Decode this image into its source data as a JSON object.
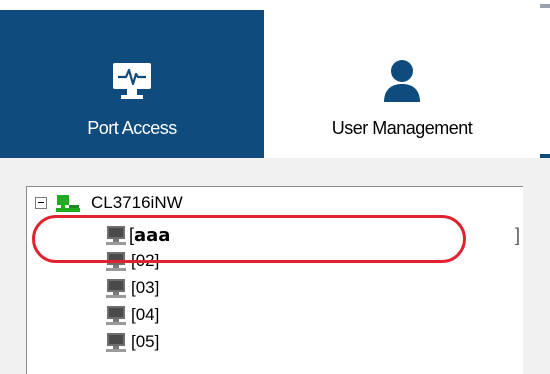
{
  "tabs": [
    {
      "label": "Port Access",
      "icon": "monitor-pulse-icon",
      "active": true
    },
    {
      "label": "User Management",
      "icon": "user-icon",
      "active": false
    }
  ],
  "tree": {
    "root_label": "CL3716iNW",
    "root_icon": "network-device-icon",
    "edit_row": {
      "open_bracket": "[",
      "value": "aaa",
      "close_bracket": "]"
    },
    "ports": [
      "[02]",
      "[03]",
      "[04]",
      "[05]"
    ],
    "port_icon": "computer-icon"
  },
  "colors": {
    "active_tab_bg": "#0f4b7c",
    "user_icon": "#0f4b7c",
    "highlight": "#e0242f",
    "root_icon": "#22aa22"
  }
}
